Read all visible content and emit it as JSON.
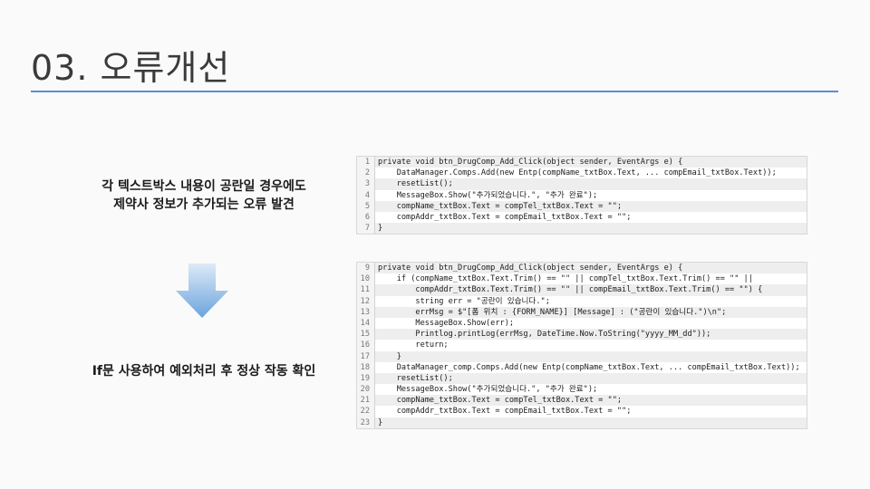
{
  "slide": {
    "title": "03. 오류개선",
    "description_top_line1": "각 텍스트박스 내용이 공란일 경우에도",
    "description_top_line2": "제약사 정보가 추가되는 오류 발견",
    "description_bottom": "If문 사용하여 예외처리 후 정상 작동 확인"
  },
  "colors": {
    "accent": "#5b8fd1",
    "arrow_top": "#ddeaf8",
    "arrow_bottom": "#6aa4dc",
    "keyword": "#9b2b6e",
    "string": "#7a9a3a"
  },
  "code_before": {
    "lines": [
      {
        "num": "1",
        "text": "private void btn_DrugComp_Add_Click(object sender, EventArgs e) {"
      },
      {
        "num": "2",
        "text": "    DataManager.Comps.Add(new Entp(compName_txtBox.Text, ... compEmail_txtBox.Text));"
      },
      {
        "num": "3",
        "text": "    resetList();"
      },
      {
        "num": "4",
        "text": "    MessageBox.Show(\"추가되었습니다.\", \"추가 완료\");"
      },
      {
        "num": "5",
        "text": "    compName_txtBox.Text = compTel_txtBox.Text = \"\";"
      },
      {
        "num": "6",
        "text": "    compAddr_txtBox.Text = compEmail_txtBox.Text = \"\";"
      },
      {
        "num": "7",
        "text": "}"
      }
    ]
  },
  "code_after": {
    "lines": [
      {
        "num": "9",
        "text": "private void btn_DrugComp_Add_Click(object sender, EventArgs e) {"
      },
      {
        "num": "10",
        "text": "    if (compName_txtBox.Text.Trim() == \"\" || compTel_txtBox.Text.Trim() == \"\" ||"
      },
      {
        "num": "11",
        "text": "        compAddr_txtBox.Text.Trim() == \"\" || compEmail_txtBox.Text.Trim() == \"\") {"
      },
      {
        "num": "12",
        "text": "        string err = \"공란이 있습니다.\";"
      },
      {
        "num": "13",
        "text": "        errMsg = $\"[폼 위치 : {FORM_NAME}] [Message] : (\"공란이 있습니다.\")\\n\";"
      },
      {
        "num": "14",
        "text": "        MessageBox.Show(err);"
      },
      {
        "num": "15",
        "text": "        Printlog.printLog(errMsg, DateTime.Now.ToString(\"yyyy_MM_dd\"));"
      },
      {
        "num": "16",
        "text": "        return;"
      },
      {
        "num": "17",
        "text": "    }"
      },
      {
        "num": "18",
        "text": "    DataManager_comp.Comps.Add(new Entp(compName_txtBox.Text, ... compEmail_txtBox.Text));"
      },
      {
        "num": "19",
        "text": "    resetList();"
      },
      {
        "num": "20",
        "text": "    MessageBox.Show(\"추가되었습니다.\", \"추가 완료\");"
      },
      {
        "num": "21",
        "text": "    compName_txtBox.Text = compTel_txtBox.Text = \"\";"
      },
      {
        "num": "22",
        "text": "    compAddr_txtBox.Text = compEmail_txtBox.Text = \"\";"
      },
      {
        "num": "23",
        "text": "}"
      }
    ]
  }
}
